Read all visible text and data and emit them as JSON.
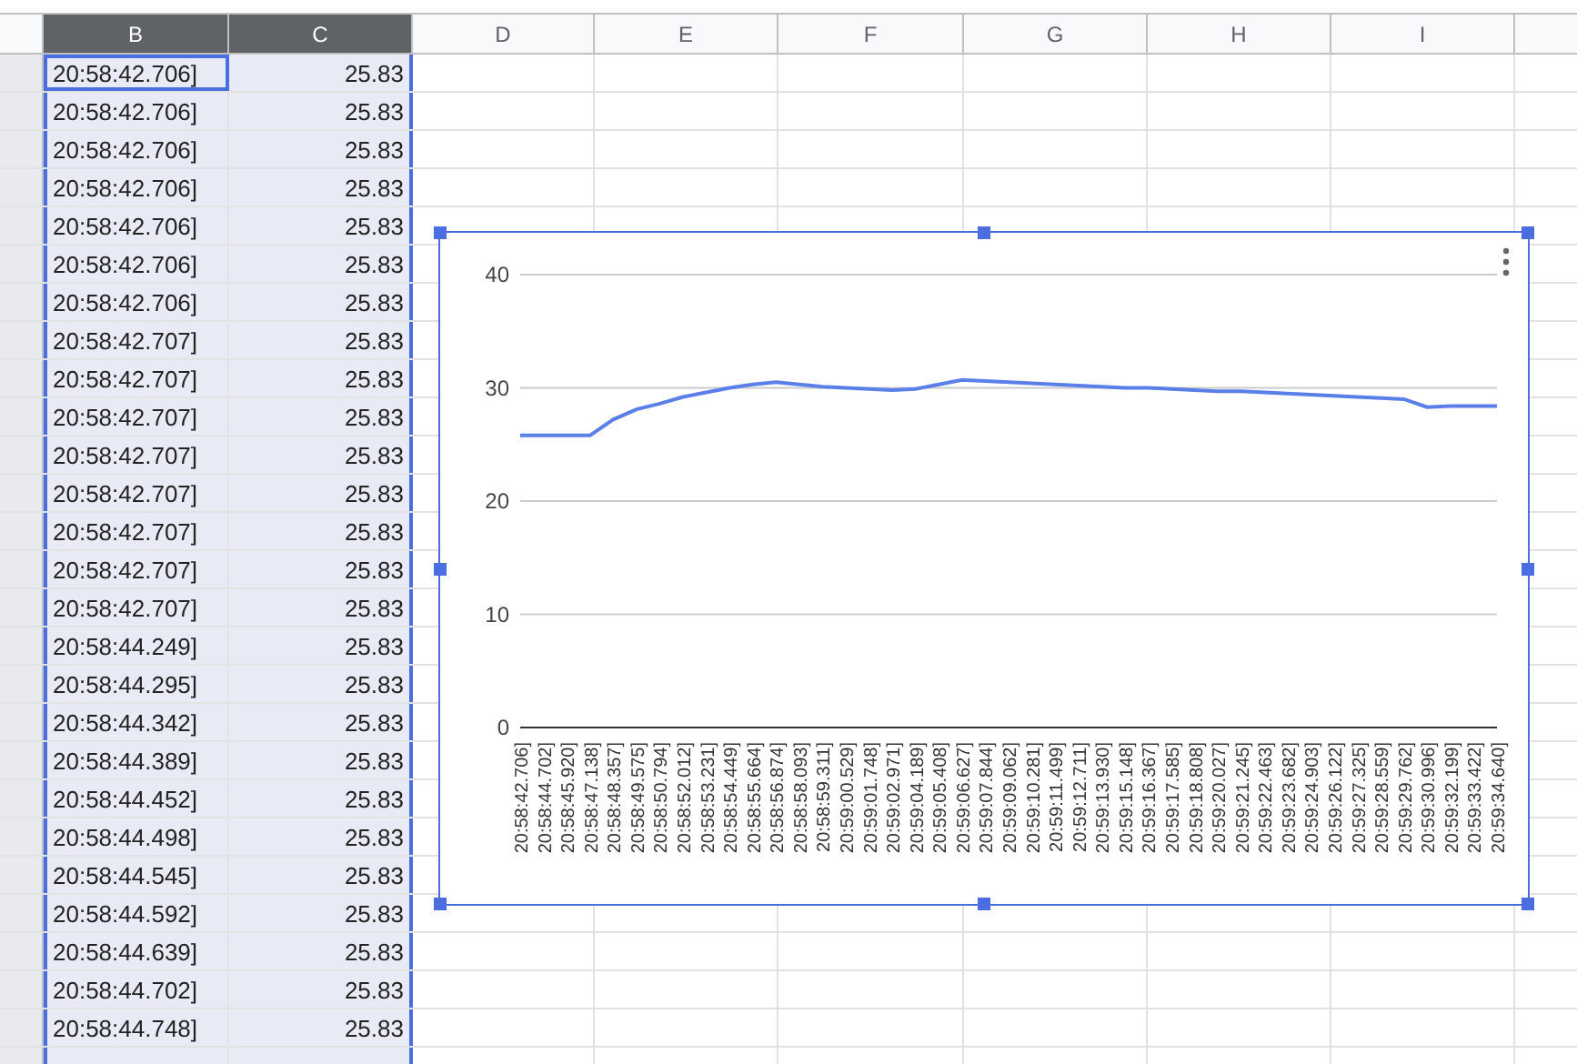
{
  "columns": [
    {
      "label": "B",
      "selected": true
    },
    {
      "label": "C",
      "selected": true
    },
    {
      "label": "D",
      "selected": false
    },
    {
      "label": "E",
      "selected": false
    },
    {
      "label": "F",
      "selected": false
    },
    {
      "label": "G",
      "selected": false
    },
    {
      "label": "H",
      "selected": false
    },
    {
      "label": "I",
      "selected": false
    }
  ],
  "rows": [
    [
      "20:58:42.706]",
      "25.83"
    ],
    [
      "20:58:42.706]",
      "25.83"
    ],
    [
      "20:58:42.706]",
      "25.83"
    ],
    [
      "20:58:42.706]",
      "25.83"
    ],
    [
      "20:58:42.706]",
      "25.83"
    ],
    [
      "20:58:42.706]",
      "25.83"
    ],
    [
      "20:58:42.706]",
      "25.83"
    ],
    [
      "20:58:42.707]",
      "25.83"
    ],
    [
      "20:58:42.707]",
      "25.83"
    ],
    [
      "20:58:42.707]",
      "25.83"
    ],
    [
      "20:58:42.707]",
      "25.83"
    ],
    [
      "20:58:42.707]",
      "25.83"
    ],
    [
      "20:58:42.707]",
      "25.83"
    ],
    [
      "20:58:42.707]",
      "25.83"
    ],
    [
      "20:58:42.707]",
      "25.83"
    ],
    [
      "20:58:44.249]",
      "25.83"
    ],
    [
      "20:58:44.295]",
      "25.83"
    ],
    [
      "20:58:44.342]",
      "25.83"
    ],
    [
      "20:58:44.389]",
      "25.83"
    ],
    [
      "20:58:44.452]",
      "25.83"
    ],
    [
      "20:58:44.498]",
      "25.83"
    ],
    [
      "20:58:44.545]",
      "25.83"
    ],
    [
      "20:58:44.592]",
      "25.83"
    ],
    [
      "20:58:44.639]",
      "25.83"
    ],
    [
      "20:58:44.702]",
      "25.83"
    ],
    [
      "20:58:44.748]",
      "25.83"
    ]
  ],
  "chart": {
    "chart_data": {
      "type": "line",
      "categories": [
        "20:58:42.706]",
        "20:58:44.702]",
        "20:58:45.920]",
        "20:58:47.138]",
        "20:58:48.357]",
        "20:58:49.575]",
        "20:58:50.794]",
        "20:58:52.012]",
        "20:58:53.231]",
        "20:58:54.449]",
        "20:58:55.664]",
        "20:58:56.874]",
        "20:58:58.093]",
        "20:58:59.311]",
        "20:59:00.529]",
        "20:59:01.748]",
        "20:59:02.971]",
        "20:59:04.189]",
        "20:59:05.408]",
        "20:59:06.627]",
        "20:59:07.844]",
        "20:59:09.062]",
        "20:59:10.281]",
        "20:59:11.499]",
        "20:59:12.711]",
        "20:59:13.930]",
        "20:59:15.148]",
        "20:59:16.367]",
        "20:59:17.585]",
        "20:59:18.808]",
        "20:59:20.027]",
        "20:59:21.245]",
        "20:59:22.463]",
        "20:59:23.682]",
        "20:59:24.903]",
        "20:59:26.122]",
        "20:59:27.325]",
        "20:59:28.559]",
        "20:59:29.762]",
        "20:59:30.996]",
        "20:59:32.199]",
        "20:59:33.422]",
        "20:59:34.640]"
      ],
      "series": [
        {
          "color": "#5b7fe8",
          "values": [
            25.8,
            25.8,
            25.8,
            25.8,
            27.2,
            28.1,
            28.6,
            29.2,
            29.6,
            30,
            30.3,
            30.5,
            30.3,
            30.1,
            30,
            29.9,
            29.8,
            29.9,
            30.3,
            30.7,
            30.6,
            30.5,
            30.4,
            30.3,
            30.2,
            30.1,
            30,
            30,
            29.9,
            29.8,
            29.7,
            29.7,
            29.6,
            29.5,
            29.4,
            29.3,
            29.2,
            29.1,
            29,
            28.3,
            28.4,
            28.4,
            28.4
          ]
        }
      ],
      "grid": true,
      "ylim": [
        0,
        40
      ],
      "yticks": [
        0,
        10,
        20,
        30,
        40
      ]
    }
  }
}
